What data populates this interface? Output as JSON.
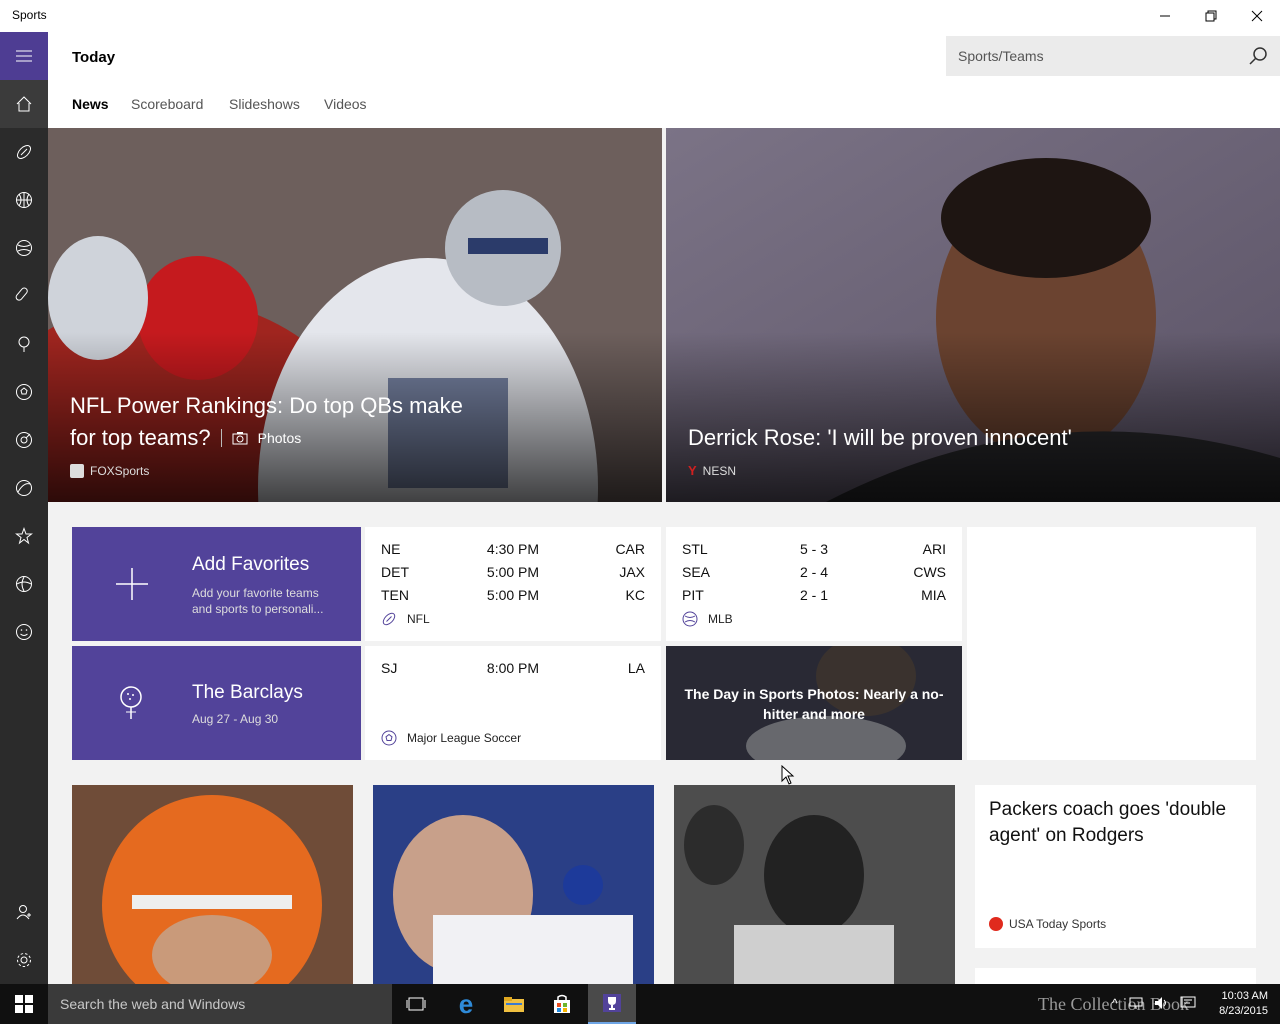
{
  "window": {
    "title": "Sports"
  },
  "header": {
    "title": "Today"
  },
  "search": {
    "placeholder": "Sports/Teams"
  },
  "tabs": [
    {
      "label": "News",
      "selected": true
    },
    {
      "label": "Scoreboard",
      "selected": false
    },
    {
      "label": "Slideshows",
      "selected": false
    },
    {
      "label": "Videos",
      "selected": false
    }
  ],
  "rail": {
    "icons": [
      "menu-icon",
      "home-icon",
      "football-icon",
      "basketball-icon",
      "baseball-icon",
      "hockey-icon",
      "golf-icon",
      "soccer-icon",
      "tennis-icon",
      "racing-icon",
      "favorites-icon",
      "sports-icon",
      "fun-icon",
      "account-icon",
      "settings-icon"
    ]
  },
  "heroes": [
    {
      "headline_1": "NFL Power Rankings: Do top QBs make",
      "headline_2": "for top teams?",
      "tag": "Photos",
      "source": "FOXSports"
    },
    {
      "headline": "Derrick Rose: 'I will be proven innocent'",
      "source": "NESN"
    }
  ],
  "add_favorites": {
    "title": "Add Favorites",
    "desc": "Add your favorite teams and sports to personali..."
  },
  "barclays": {
    "title": "The Barclays",
    "dates": "Aug 27 - Aug 30"
  },
  "nfl": {
    "league": "NFL",
    "games": [
      {
        "home": "NE",
        "mid": "4:30 PM",
        "away": "CAR"
      },
      {
        "home": "DET",
        "mid": "5:00 PM",
        "away": "JAX"
      },
      {
        "home": "TEN",
        "mid": "5:00 PM",
        "away": "KC"
      }
    ]
  },
  "mlb": {
    "league": "MLB",
    "games": [
      {
        "home": "STL",
        "mid": "5  -  3",
        "away": "ARI"
      },
      {
        "home": "SEA",
        "mid": "2  -  4",
        "away": "CWS"
      },
      {
        "home": "PIT",
        "mid": "2  -  1",
        "away": "MIA"
      }
    ]
  },
  "mls": {
    "league": "Major League Soccer",
    "games": [
      {
        "home": "SJ",
        "mid": "8:00 PM",
        "away": "LA"
      }
    ]
  },
  "day_in_sports": {
    "title": "The Day in Sports Photos: Nearly a no-hitter and more"
  },
  "packers": {
    "title": "Packers coach goes 'double agent' on Rodgers",
    "source": "USA Today Sports"
  },
  "taskbar": {
    "search_placeholder": "Search the web and Windows",
    "time": "10:03 AM",
    "date": "8/23/2015",
    "watermark": "The Collection Book"
  },
  "colors": {
    "accent": "#52439a",
    "rail": "#2b2b2b",
    "taskbar": "#101010"
  }
}
